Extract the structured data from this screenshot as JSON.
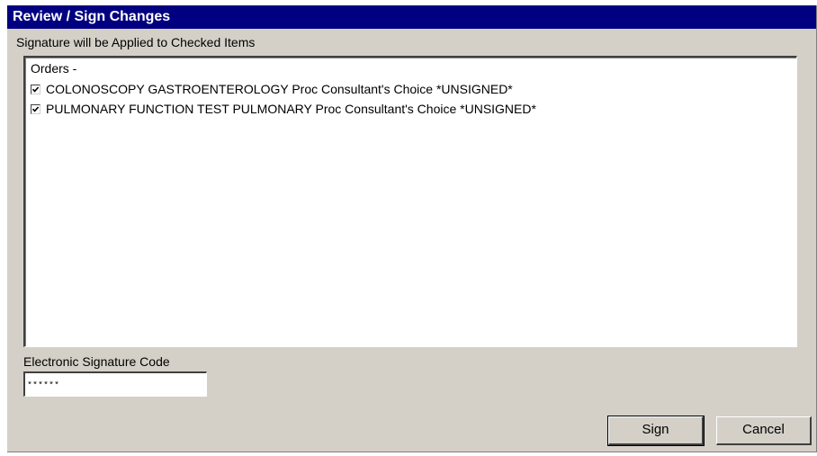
{
  "window": {
    "title": "Review / Sign Changes"
  },
  "list": {
    "caption": "Signature will be Applied to Checked Items",
    "group_header": "Orders -",
    "items": [
      {
        "label": "COLONOSCOPY GASTROENTEROLOGY Proc Consultant's Choice *UNSIGNED*",
        "checked": true
      },
      {
        "label": "PULMONARY FUNCTION TEST PULMONARY Proc Consultant's Choice *UNSIGNED*",
        "checked": true
      }
    ]
  },
  "signature": {
    "label": "Electronic Signature Code",
    "value": "******"
  },
  "buttons": {
    "sign": "Sign",
    "cancel": "Cancel"
  },
  "icons": {
    "check": "check-icon"
  }
}
